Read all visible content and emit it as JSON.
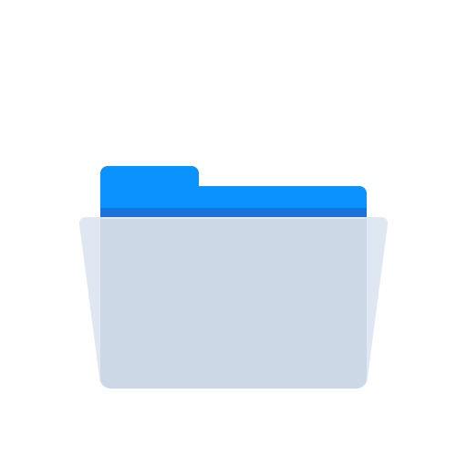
{
  "icon": {
    "name": "folder-open-icon",
    "colors": {
      "background": "#ffffff",
      "tab": "#0a93fd",
      "back_panel": "#0a93fd",
      "back_panel_stripe": "#1a72df",
      "front_panel_outer": "#dfe7f2",
      "front_panel_inner": "#cdd8e6"
    }
  }
}
